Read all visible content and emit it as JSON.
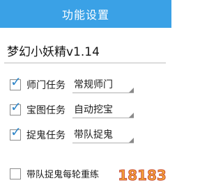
{
  "header": {
    "title": "功能设置"
  },
  "app": {
    "name": "梦幻小妖精v1.14"
  },
  "tasks": [
    {
      "checked": true,
      "label": "师门任务",
      "mode": "常规师门"
    },
    {
      "checked": true,
      "label": "宝图任务",
      "mode": "自动挖宝"
    },
    {
      "checked": true,
      "label": "捉鬼任务",
      "mode": "带队捉鬼"
    }
  ],
  "options": [
    {
      "checked": false,
      "label": "带队捉鬼每轮重练"
    }
  ],
  "watermark": {
    "text": "18183"
  },
  "colors": {
    "header_bg": "#3aa1e6",
    "checkmark": "#2f86c8"
  }
}
